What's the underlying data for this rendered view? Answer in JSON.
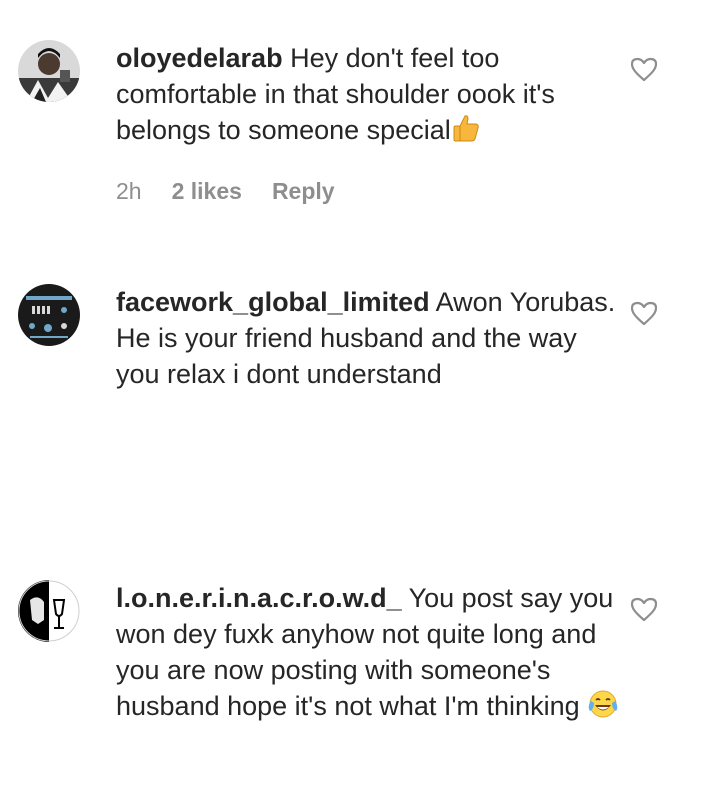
{
  "comments": [
    {
      "username": "oloyedelarab",
      "text": " Hey don't feel too comfortable in that shoulder oook it's belongs to someone special",
      "emoji": "thumbs-up",
      "meta": {
        "time": "2h",
        "likes": "2 likes",
        "reply": "Reply"
      }
    },
    {
      "username": "facework_global_limited",
      "text": " Awon Yorubas. He is your friend husband and the way you relax i dont understand",
      "emoji": ""
    },
    {
      "username": "l.o.n.e.r.i.n.a.c.r.o.w.d_",
      "text": " You post say you won dey fuxk anyhow not quite long and you are now posting with someone's husband hope it's not what I'm thinking",
      "emoji": "tears-of-joy"
    }
  ],
  "icons": {
    "like": "heart-outline-icon"
  },
  "colors": {
    "text": "#262626",
    "meta": "#8e8e8e",
    "heart": "#8e8e8e"
  }
}
